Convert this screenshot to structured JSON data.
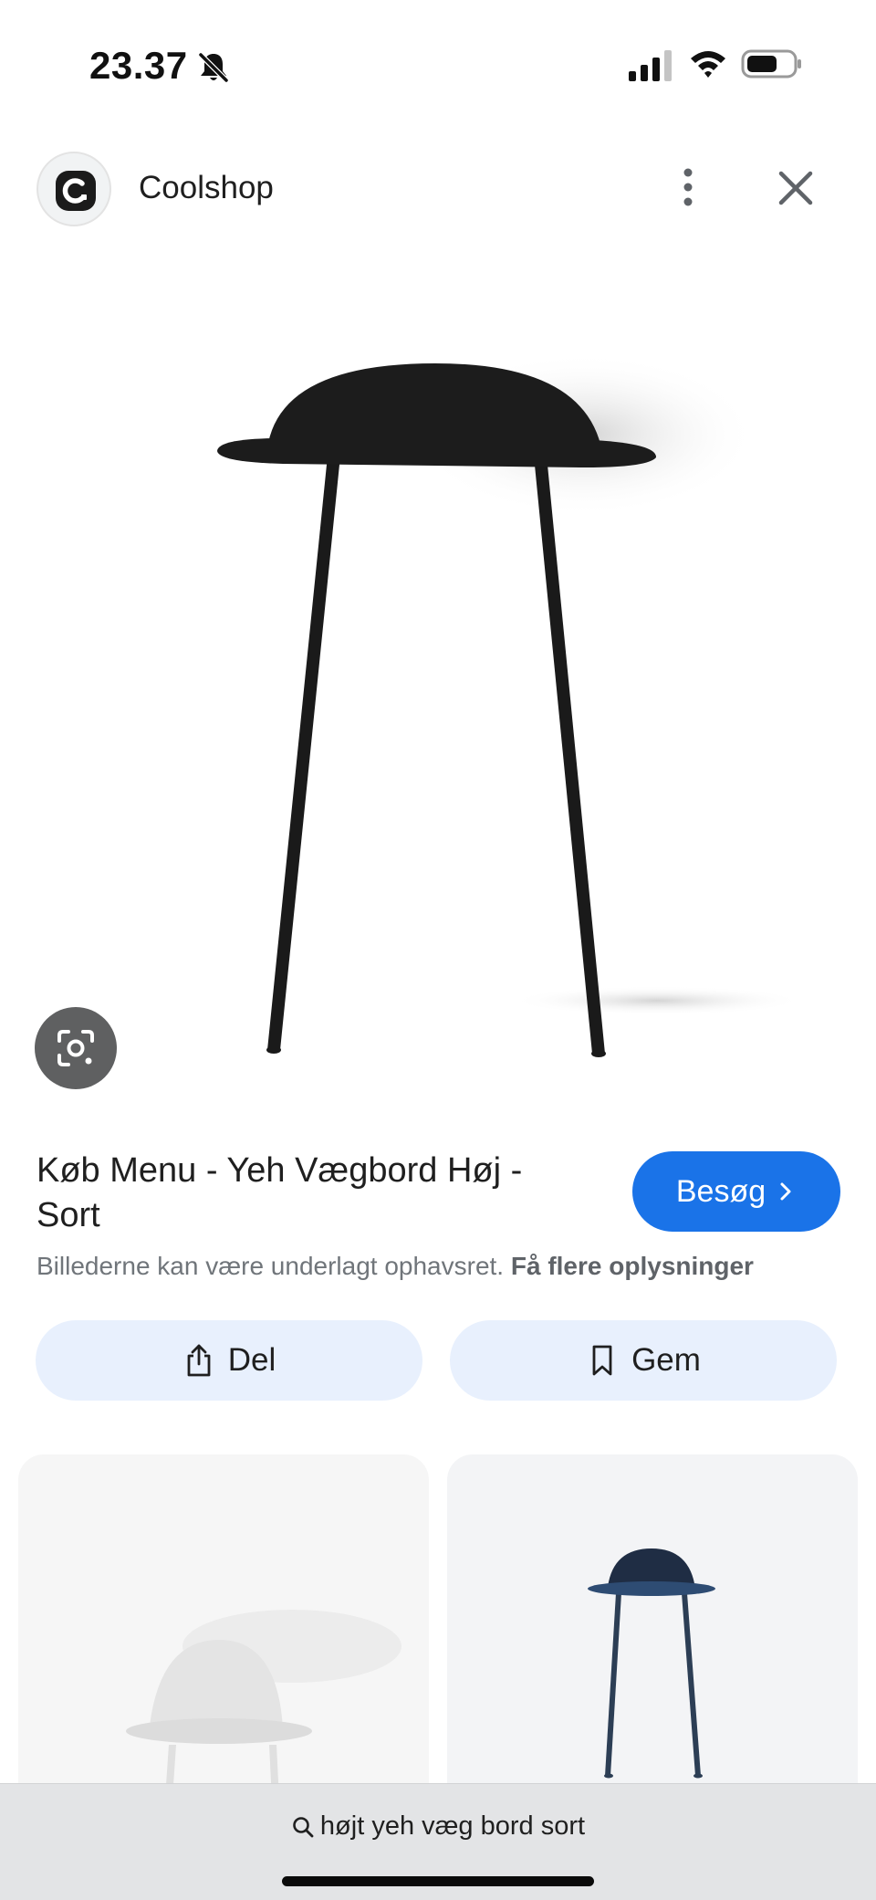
{
  "status_bar": {
    "time": "23.37",
    "icons": [
      "bell-slash-icon",
      "cellular-signal-icon",
      "wifi-icon",
      "battery-icon"
    ]
  },
  "header": {
    "site_name": "Coolshop",
    "logo_icon": "coolshop-logo-icon",
    "more_icon": "more-vertical-icon",
    "close_icon": "close-icon"
  },
  "hero": {
    "image": "black-wall-table-image",
    "lens_icon": "google-lens-icon"
  },
  "result": {
    "title": "Køb Menu - Yeh Vægbord Høj - Sort",
    "visit_label": "Besøg",
    "copyright_text": "Billederne kan være underlagt ophavsret.",
    "more_info_link": "Få flere oplysninger"
  },
  "actions": {
    "share_label": "Del",
    "save_label": "Gem"
  },
  "related": [
    {
      "image": "white-wall-table-image"
    },
    {
      "image": "navy-wall-table-image"
    }
  ],
  "search": {
    "query": "højt yeh væg bord sort"
  },
  "colors": {
    "accent": "#1a73e8",
    "chip_background": "#e8f0fd",
    "secondary_text": "#70757a",
    "bottom_bar": "#e3e4e6"
  }
}
